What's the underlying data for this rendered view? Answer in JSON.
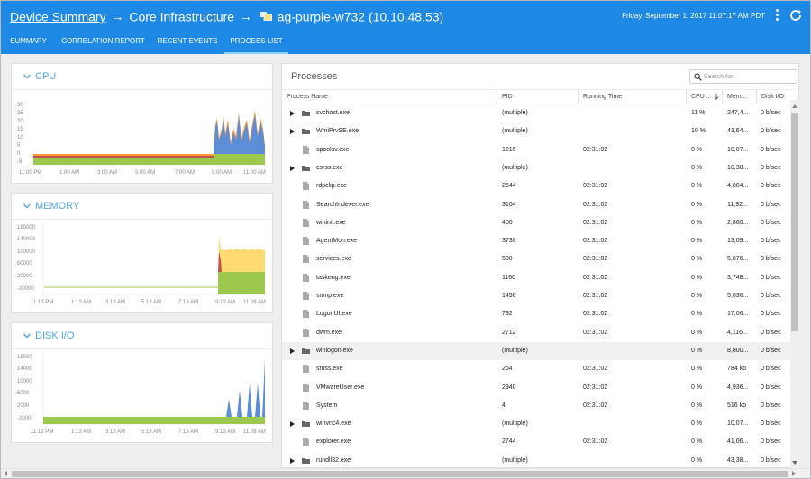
{
  "header": {
    "breadcrumb": {
      "root": "Device Summary",
      "arrow": "→",
      "group": "Core Infrastructure",
      "device": "ag-purple-w732 (10.10.48.53)"
    },
    "datetime": "Friday, September 1, 2017 11:07:17 AM PDT",
    "icons": {
      "menu": "kebab-menu-icon",
      "refresh": "refresh-icon",
      "device": "device-icon"
    }
  },
  "tabs": [
    {
      "label": "SUMMARY",
      "active": false
    },
    {
      "label": "CORRELATION REPORT",
      "active": false
    },
    {
      "label": "RECENT EVENTS",
      "active": false
    },
    {
      "label": "PROCESS LIST",
      "active": true
    }
  ],
  "colors": {
    "brand": "#1e88e5",
    "panel_title": "#53a6e6",
    "series_blue": "#5b8ed6",
    "series_orange": "#ff9a35",
    "series_yellow": "#fedb70",
    "series_red": "#c74b4f",
    "series_green": "#9cc84e"
  },
  "panels": {
    "cpu": {
      "title": "CPU",
      "chart_data": {
        "type": "area",
        "y_ticks": [
          "30",
          "25",
          "20",
          "15",
          "10",
          "5",
          "0",
          "-5"
        ],
        "x_ticks": [
          "11:00 PM",
          "1:00 AM",
          "3:00 AM",
          "5:00 AM",
          "7:00 AM",
          "9:00 AM",
          "11:00 AM"
        ],
        "ylim": [
          -5,
          30
        ],
        "baseline": {
          "green": [
            -5,
            0
          ],
          "red": [
            0,
            0.5
          ],
          "orange": [
            0.5,
            1
          ]
        },
        "activity_start": "9:00 AM",
        "activity_peak": 29
      }
    },
    "memory": {
      "title": "MEMORY",
      "chart_data": {
        "type": "area",
        "y_ticks": [
          "180000",
          "140000",
          "100000",
          "60000",
          "20000",
          "-20000"
        ],
        "x_ticks": [
          "11:13 PM",
          "1:13 AM",
          "3:13 AM",
          "5:13 AM",
          "7:13 AM",
          "9:13 AM",
          "11:08 AM"
        ],
        "ylim": [
          -20000,
          180000
        ],
        "before": 0,
        "after": {
          "green": [
            -20000,
            40000
          ],
          "red": [
            40000,
            70000
          ],
          "yellow": [
            40000,
            110000
          ]
        },
        "spike": 150000
      }
    },
    "disk": {
      "title": "DISK I/O",
      "chart_data": {
        "type": "area",
        "y_ticks": [
          "18000",
          "14000",
          "10000",
          "6000",
          "2000",
          "-2000"
        ],
        "x_ticks": [
          "11:13 PM",
          "1:13 AM",
          "3:13 AM",
          "5:13 AM",
          "7:13 AM",
          "9:13 AM",
          "11:08 AM"
        ],
        "ylim": [
          -2000,
          18000
        ],
        "baseline": [
          -2000,
          0
        ],
        "spikes": [
          7500,
          10000,
          12500,
          13000,
          16000
        ]
      }
    }
  },
  "processes": {
    "title": "Processes",
    "search_placeholder": "Search for...",
    "columns": [
      "Process Name",
      "PID",
      "Running Time",
      "CPU ...",
      "Mem...",
      "Disk I/O"
    ],
    "rows": [
      {
        "name": "svchost.exe",
        "pid": "(multiple)",
        "time": "",
        "cpu": "11 %",
        "mem": "247,4...",
        "disk": "0 b/sec",
        "group": true,
        "highlight": false
      },
      {
        "name": "WmiPrvSE.exe",
        "pid": "(multiple)",
        "time": "",
        "cpu": "10 %",
        "mem": "43,64...",
        "disk": "0 b/sec",
        "group": true,
        "highlight": false
      },
      {
        "name": "spoolsv.exe",
        "pid": "1216",
        "time": "02:31:02",
        "cpu": "0 %",
        "mem": "10,07...",
        "disk": "0 b/sec",
        "group": false,
        "highlight": false
      },
      {
        "name": "csrss.exe",
        "pid": "(multiple)",
        "time": "",
        "cpu": "0 %",
        "mem": "10,38...",
        "disk": "0 b/sec",
        "group": true,
        "highlight": false
      },
      {
        "name": "rdpclip.exe",
        "pid": "2644",
        "time": "02:31:02",
        "cpu": "0 %",
        "mem": "4,804...",
        "disk": "0 b/sec",
        "group": false,
        "highlight": false
      },
      {
        "name": "SearchIndexer.exe",
        "pid": "3104",
        "time": "02:31:02",
        "cpu": "0 %",
        "mem": "11,92...",
        "disk": "0 b/sec",
        "group": false,
        "highlight": false
      },
      {
        "name": "wininit.exe",
        "pid": "400",
        "time": "02:31:02",
        "cpu": "0 %",
        "mem": "2,860...",
        "disk": "0 b/sec",
        "group": false,
        "highlight": false
      },
      {
        "name": "AgentMon.exe",
        "pid": "3736",
        "time": "02:31:02",
        "cpu": "0 %",
        "mem": "13,09...",
        "disk": "0 b/sec",
        "group": false,
        "highlight": false
      },
      {
        "name": "services.exe",
        "pid": "508",
        "time": "02:31:02",
        "cpu": "0 %",
        "mem": "5,876...",
        "disk": "0 b/sec",
        "group": false,
        "highlight": false
      },
      {
        "name": "taskeng.exe",
        "pid": "1160",
        "time": "02:31:02",
        "cpu": "0 %",
        "mem": "3,748...",
        "disk": "0 b/sec",
        "group": false,
        "highlight": false
      },
      {
        "name": "snmp.exe",
        "pid": "1456",
        "time": "02:31:02",
        "cpu": "0 %",
        "mem": "5,036...",
        "disk": "0 b/sec",
        "group": false,
        "highlight": false
      },
      {
        "name": "LogonUI.exe",
        "pid": "792",
        "time": "02:31:02",
        "cpu": "0 %",
        "mem": "17,06...",
        "disk": "0 b/sec",
        "group": false,
        "highlight": false
      },
      {
        "name": "dwm.exe",
        "pid": "2712",
        "time": "02:31:02",
        "cpu": "0 %",
        "mem": "4,116...",
        "disk": "0 b/sec",
        "group": false,
        "highlight": false
      },
      {
        "name": "winlogon.exe",
        "pid": "(multiple)",
        "time": "",
        "cpu": "0 %",
        "mem": "8,800...",
        "disk": "0 b/sec",
        "group": true,
        "highlight": true
      },
      {
        "name": "smss.exe",
        "pid": "264",
        "time": "02:31:02",
        "cpu": "0 %",
        "mem": "784 kb",
        "disk": "0 b/sec",
        "group": false,
        "highlight": false
      },
      {
        "name": "VMwareUser.exe",
        "pid": "2940",
        "time": "02:31:02",
        "cpu": "0 %",
        "mem": "4,936...",
        "disk": "0 b/sec",
        "group": false,
        "highlight": false
      },
      {
        "name": "System",
        "pid": "4",
        "time": "02:31:02",
        "cpu": "0 %",
        "mem": "516 kb",
        "disk": "0 b/sec",
        "group": false,
        "highlight": false
      },
      {
        "name": "winvnc4.exe",
        "pid": "(multiple)",
        "time": "",
        "cpu": "0 %",
        "mem": "10,07...",
        "disk": "0 b/sec",
        "group": true,
        "highlight": false
      },
      {
        "name": "explorer.exe",
        "pid": "2744",
        "time": "02:31:02",
        "cpu": "0 %",
        "mem": "41,06...",
        "disk": "0 b/sec",
        "group": false,
        "highlight": false
      },
      {
        "name": "rundll32.exe",
        "pid": "(multiple)",
        "time": "",
        "cpu": "0 %",
        "mem": "43,38...",
        "disk": "0 b/sec",
        "group": true,
        "highlight": false
      }
    ]
  }
}
